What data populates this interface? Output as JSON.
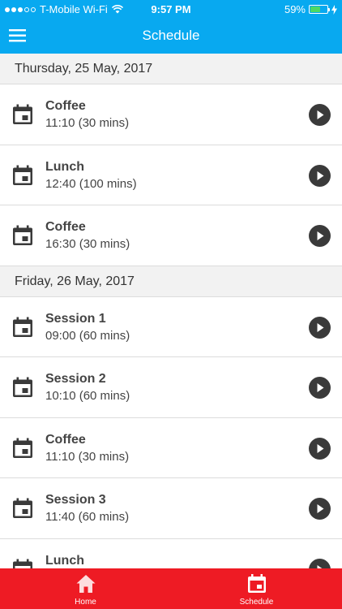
{
  "status_bar": {
    "carrier": "T-Mobile Wi-Fi",
    "time": "9:57 PM",
    "battery_percent": "59%",
    "battery_level": 0.59
  },
  "header": {
    "title": "Schedule",
    "menu_icon": "hamburger-menu-icon"
  },
  "colors": {
    "header_bg": "#08a9f0",
    "tab_bar_bg": "#ee1b24",
    "day_header_bg": "#f2f2f2",
    "icon_dark": "#3a3a3a"
  },
  "days": [
    {
      "date": "Thursday, 25 May, 2017",
      "events": [
        {
          "title": "Coffee",
          "time": "11:10 (30 mins)"
        },
        {
          "title": "Lunch",
          "time": "12:40 (100 mins)"
        },
        {
          "title": "Coffee",
          "time": "16:30 (30 mins)"
        }
      ]
    },
    {
      "date": "Friday, 26 May, 2017",
      "events": [
        {
          "title": "Session 1",
          "time": "09:00 (60 mins)"
        },
        {
          "title": "Session 2",
          "time": "10:10 (60 mins)"
        },
        {
          "title": "Coffee",
          "time": "11:10 (30 mins)"
        },
        {
          "title": "Session 3",
          "time": "11:40 (60 mins)"
        },
        {
          "title": "Lunch",
          "time": ""
        }
      ]
    }
  ],
  "tabs": [
    {
      "label": "Home",
      "icon": "home-icon"
    },
    {
      "label": "Schedule",
      "icon": "calendar-icon"
    }
  ]
}
